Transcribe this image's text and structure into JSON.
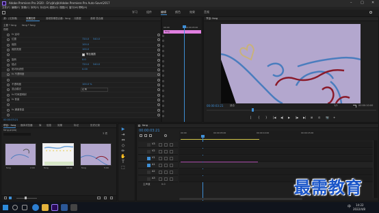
{
  "titlebar": {
    "title": "Adobe Premiere Pro 2020 - D:\\zjb\\zjb\\Adobe Premiere Pro Auto-Save\\2017",
    "controls": [
      "–",
      "□",
      "✕"
    ]
  },
  "menubar": {
    "items": [
      "文件(F)",
      "编辑(E)",
      "剪辑(C)",
      "序列(S)",
      "标记(M)",
      "图形(G)",
      "视图(V)",
      "窗口(W)",
      "帮助(H)"
    ]
  },
  "workspaces": {
    "tabs": [
      "学习",
      "组件",
      "编辑",
      "颜色",
      "效果",
      "音频"
    ],
    "active_index": 2
  },
  "effect_controls": {
    "tabs": [
      "源：(无剪辑)",
      "效果控件",
      "音频剪辑混合器：fang",
      "元数据",
      "音频 混合器"
    ],
    "active_tab": 1,
    "master_label": "主要 * fang",
    "sequence_label": "fang * fang",
    "section_video": "视频",
    "rows": [
      {
        "name": "fx 运动",
        "value": "",
        "value2": ""
      },
      {
        "name": "位置",
        "value": "720.0",
        "value2": "540.0"
      },
      {
        "name": "缩放",
        "value": "100.0",
        "value2": ""
      },
      {
        "name": "缩放宽度",
        "value": "100.0",
        "value2": ""
      },
      {
        "name": "",
        "value": "等比缩放",
        "value2": ""
      },
      {
        "name": "旋转",
        "value": "0.0",
        "value2": ""
      },
      {
        "name": "锚点",
        "value": "720.0",
        "value2": "540.0"
      },
      {
        "name": "防闪烁滤镜",
        "value": "0.00",
        "value2": ""
      },
      {
        "name": "fx 不透明度",
        "value": "",
        "value2": ""
      },
      {
        "name": "",
        "value": "",
        "value2": ""
      },
      {
        "name": "不透明度",
        "value": "100.0 %",
        "value2": ""
      },
      {
        "name": "混合模式",
        "value": "正常",
        "value2": ""
      },
      {
        "name": "fx 时间重映射",
        "value": "",
        "value2": ""
      },
      {
        "name": "fx 音量",
        "value": "",
        "value2": ""
      },
      {
        "name": "",
        "value": "",
        "value2": ""
      },
      {
        "name": "fx 通道音量",
        "value": "",
        "value2": ""
      },
      {
        "name": "",
        "value": "",
        "value2": ""
      }
    ],
    "timecode": "00:00:03:21",
    "mini_ruler": [
      "00:00",
      "00:00:05:00"
    ],
    "mini_clip": "fang"
  },
  "program": {
    "title": "节目: fang",
    "timecode": "00:00:03:21",
    "fit": "适合",
    "quality": "1/2",
    "duration": "00:00:10:00",
    "controls": [
      "▏",
      "{",
      "}",
      "|◀",
      "◀|",
      "▶",
      "|▶",
      "▶|",
      "⊞",
      "⊡",
      "📷",
      "+"
    ],
    "colors": {
      "background": "#b3a7ce",
      "blue_line": "#4a7dbe",
      "red_line": "#8a1a2a",
      "heart": "#c9b27a"
    }
  },
  "project": {
    "tabs": [
      "项目：fang",
      "媒体浏览器",
      "库",
      "信息",
      "效果",
      "标记",
      "历史记录"
    ],
    "active_tab": 0,
    "project_file": "fang.prproj",
    "items_count": "3 项",
    "thumbs": [
      {
        "label": "fang",
        "duration": "2:00"
      },
      {
        "label": "fang",
        "duration": "10:00"
      },
      {
        "label": "fang",
        "duration": "5:00"
      }
    ]
  },
  "tools": {
    "icons": [
      "▶",
      "⇥",
      "⇔",
      "◇",
      "✏",
      "✋",
      "T",
      "⬚"
    ]
  },
  "timeline": {
    "tab": "fang",
    "timecode": "00:00:03:21",
    "ruler": [
      "00:00",
      "00:00:05:00",
      "00:00:10:00",
      "00:00:15:00"
    ],
    "tracks": [
      "V3",
      "V2",
      "V1",
      "A1",
      "A2",
      "A3"
    ],
    "master": "主声道",
    "master_value": "0.0",
    "clip1": "fang",
    "clip2": "fang",
    "playhead_fraction": 0.18
  },
  "taskbar": {
    "time": "14:22",
    "date": "2022/4/8",
    "lang": "中"
  },
  "watermark": "最需教育"
}
